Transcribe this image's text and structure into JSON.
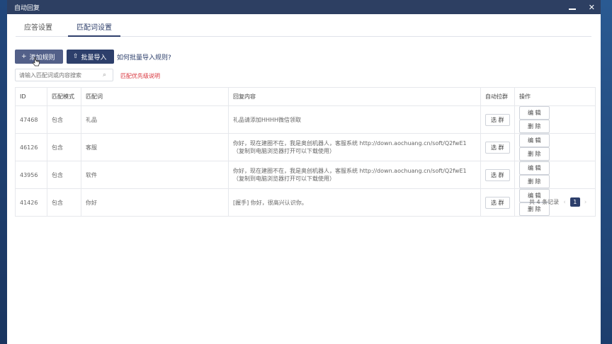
{
  "window": {
    "title": "自动回复",
    "minimize_icon": "minimize-icon",
    "close_symbol": "✕"
  },
  "tabs": [
    {
      "label": "应答设置",
      "active": false
    },
    {
      "label": "匹配词设置",
      "active": true
    }
  ],
  "toolbar": {
    "add_icon": "+",
    "add_label": "添加规则",
    "import_icon": "⇧",
    "import_label": "批量导入",
    "help_link": "如何批量导入规则?"
  },
  "search": {
    "placeholder": "请输入匹配词或内容搜索",
    "icon": "search-icon"
  },
  "priority_link": "匹配优先级说明",
  "table": {
    "headers": [
      "ID",
      "匹配模式",
      "匹配词",
      "回复内容",
      "自动拉群",
      "操作"
    ],
    "rows": [
      {
        "id": "47468",
        "mode": "包含",
        "keyword": "礼品",
        "reply_line1": "礼品请添加HHHH微信领取",
        "reply_line2": "",
        "pull_label": "选 群",
        "edit_label": "编 辑",
        "delete_label": "删 除"
      },
      {
        "id": "46126",
        "mode": "包含",
        "keyword": "客服",
        "reply_line1": "你好，现在建圈不在，我是奥创机器人，客服系统 http://down.aochuang.cn/soft/Q2fwE1",
        "reply_line2": "（复制到电脑浏览器打开可以下载使用）",
        "pull_label": "选 群",
        "edit_label": "编 辑",
        "delete_label": "删 除"
      },
      {
        "id": "43956",
        "mode": "包含",
        "keyword": "软件",
        "reply_line1": "你好，现在建圈不在，我是奥创机器人，客服系统 http://down.aochuang.cn/soft/Q2fwE1",
        "reply_line2": "（复制到电脑浏览器打开可以下载使用）",
        "pull_label": "选 群",
        "edit_label": "编 辑",
        "delete_label": "删 除"
      },
      {
        "id": "41426",
        "mode": "包含",
        "keyword": "你好",
        "reply_line1": "[握手] 你好，很高兴认识你。",
        "reply_line2": "",
        "pull_label": "选 群",
        "edit_label": "编 辑",
        "delete_label": "删 除"
      }
    ]
  },
  "pagination": {
    "total": "共 4 条记录",
    "prev": "‹",
    "page": "1",
    "next": "›"
  }
}
